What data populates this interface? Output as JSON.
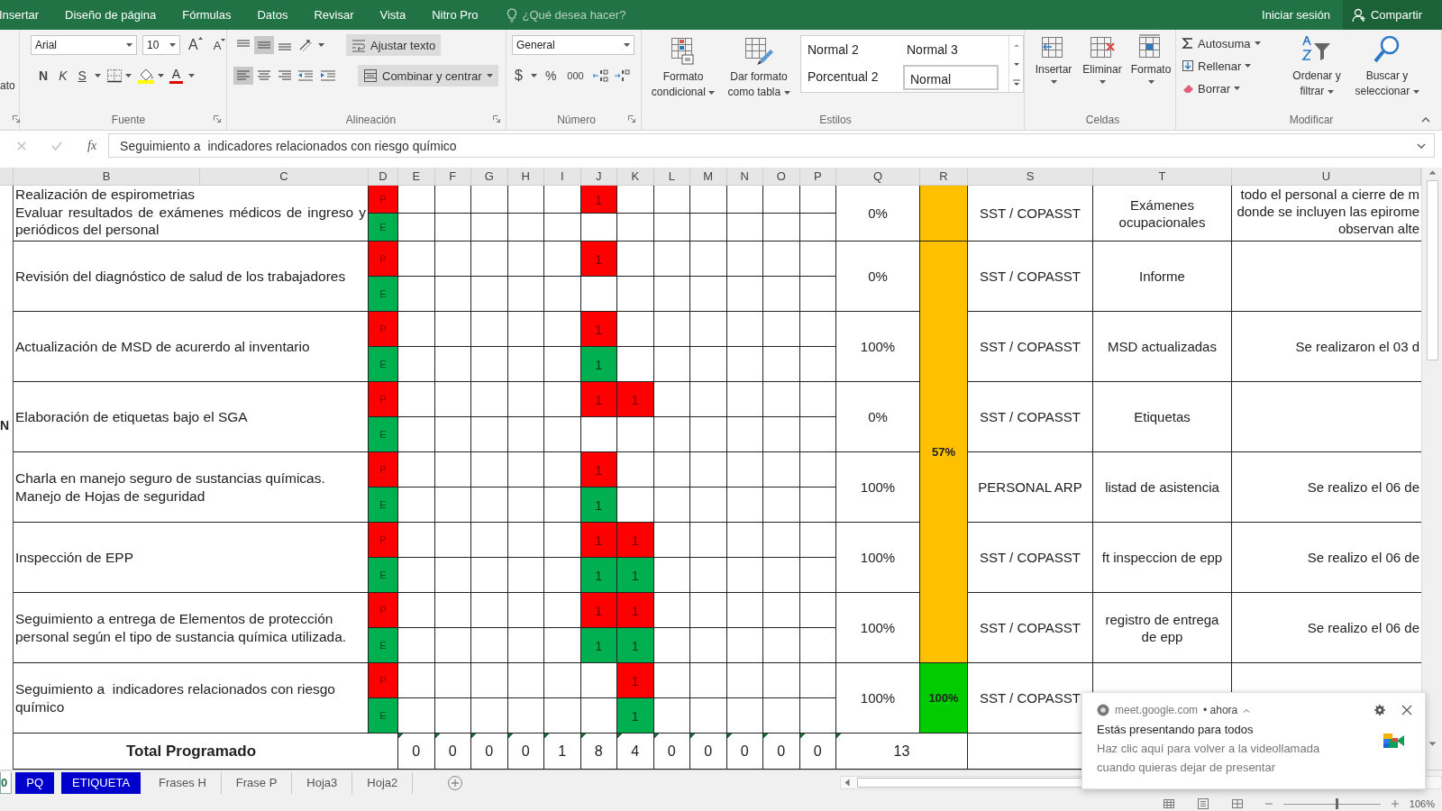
{
  "menu_tabs": [
    "Insertar",
    "Diseño de página",
    "Fórmulas",
    "Datos",
    "Revisar",
    "Vista",
    "Nitro Pro"
  ],
  "tell_me": {
    "placeholder": "¿Qué desea hacer?"
  },
  "account": {
    "sign_in": "Iniciar sesión",
    "share": "Compartir"
  },
  "ribbon": {
    "clipped_group": {
      "label": "ato"
    },
    "font": {
      "name": "Arial",
      "size": "10",
      "grow": "A",
      "shrink": "A",
      "bold": "N",
      "italic": "K",
      "underline": "S",
      "font_color": "A",
      "label": "Fuente"
    },
    "alignment": {
      "wrap_text": "Ajustar texto",
      "merge": "Combinar y centrar",
      "label": "Alineación"
    },
    "number": {
      "format": "General",
      "currency": "$",
      "percent": "%",
      "thousands": "000",
      "label": "Número"
    },
    "styles": {
      "conditional": "Formato condicional",
      "as_table": "Dar formato como tabla",
      "label": "Estilos",
      "gallery": [
        {
          "label": "Normal 2",
          "selected": false
        },
        {
          "label": "Normal 3",
          "selected": false
        },
        {
          "label": "Porcentual 2",
          "selected": false
        },
        {
          "label": "Normal",
          "selected": true
        }
      ]
    },
    "cells": {
      "buttons": [
        "Insertar",
        "Eliminar",
        "Formato"
      ],
      "label": "Celdas"
    },
    "editing": {
      "autosum": "Autosuma",
      "fill": "Rellenar",
      "clear": "Borrar",
      "sort": "Ordenar y filtrar",
      "find": "Buscar y seleccionar",
      "label": "Modificar"
    }
  },
  "formula_bar": {
    "function_label": "fx",
    "content": "Seguimiento a  indicadores relacionados con riesgo químico"
  },
  "sheet": {
    "columns": [
      "B",
      "C",
      "D",
      "E",
      "F",
      "G",
      "H",
      "I",
      "J",
      "K",
      "L",
      "M",
      "N",
      "O",
      "P",
      "Q",
      "R",
      "S",
      "T",
      "U"
    ],
    "column_a_fragment": "N",
    "tasks": [
      {
        "activity": "Realización de espirometrias\nEvaluar resultados de exámenes médicos de ingreso y periódicos del personal",
        "plan_label": "P",
        "exec_label": "E",
        "plan": [
          {
            "filled": false
          },
          {
            "filled": false
          },
          {
            "filled": false
          },
          {
            "filled": false
          },
          {
            "filled": false
          },
          {
            "filled": true,
            "value": "1"
          },
          {
            "filled": false
          },
          {
            "filled": false
          },
          {
            "filled": false
          },
          {
            "filled": false
          },
          {
            "filled": false
          },
          {
            "filled": false
          }
        ],
        "exec": [
          {
            "filled": false
          },
          {
            "filled": false
          },
          {
            "filled": false
          },
          {
            "filled": false
          },
          {
            "filled": false
          },
          {
            "filled": false
          },
          {
            "filled": false
          },
          {
            "filled": false
          },
          {
            "filled": false
          },
          {
            "filled": false
          },
          {
            "filled": false
          },
          {
            "filled": false
          }
        ],
        "percent": "0%",
        "summary": {
          "color": "#ffc000"
        },
        "responsible": "SST / COPASST",
        "evidence": "Exámenes ocupacionales",
        "observation": "todo el personal a cierre de m\ndonde se incluyen las epirome\nobservan alte"
      },
      {
        "activity": "Revisión del diagnóstico de salud de los trabajadores",
        "plan_label": "P",
        "exec_label": "E",
        "plan": [
          {
            "filled": false
          },
          {
            "filled": false
          },
          {
            "filled": false
          },
          {
            "filled": false
          },
          {
            "filled": false
          },
          {
            "filled": true,
            "value": "1"
          },
          {
            "filled": false
          },
          {
            "filled": false
          },
          {
            "filled": false
          },
          {
            "filled": false
          },
          {
            "filled": false
          },
          {
            "filled": false
          }
        ],
        "exec": [
          {
            "filled": false
          },
          {
            "filled": false
          },
          {
            "filled": false
          },
          {
            "filled": false
          },
          {
            "filled": false
          },
          {
            "filled": false
          },
          {
            "filled": false
          },
          {
            "filled": false
          },
          {
            "filled": false
          },
          {
            "filled": false
          },
          {
            "filled": false
          },
          {
            "filled": false
          }
        ],
        "percent": "0%",
        "summary": {
          "value": "57%",
          "color": "#ffc000"
        },
        "responsible": "SST / COPASST",
        "evidence": "Informe"
      },
      {
        "activity": "Actualización de MSD de acurerdo al inventario",
        "plan_label": "P",
        "exec_label": "E",
        "plan": [
          {
            "filled": false
          },
          {
            "filled": false
          },
          {
            "filled": false
          },
          {
            "filled": false
          },
          {
            "filled": false
          },
          {
            "filled": true,
            "value": "1"
          },
          {
            "filled": false
          },
          {
            "filled": false
          },
          {
            "filled": false
          },
          {
            "filled": false
          },
          {
            "filled": false
          },
          {
            "filled": false
          }
        ],
        "exec": [
          {
            "filled": false
          },
          {
            "filled": false
          },
          {
            "filled": false
          },
          {
            "filled": false
          },
          {
            "filled": false
          },
          {
            "filled": true,
            "value": "1"
          },
          {
            "filled": false
          },
          {
            "filled": false
          },
          {
            "filled": false
          },
          {
            "filled": false
          },
          {
            "filled": false
          },
          {
            "filled": false
          }
        ],
        "percent": "100%",
        "responsible": "SST / COPASST",
        "evidence": "MSD actualizadas",
        "observation": "Se realizaron el 03 d"
      },
      {
        "activity": "Elaboración de etiquetas bajo el SGA",
        "plan_label": "P",
        "exec_label": "E",
        "plan": [
          {
            "filled": false
          },
          {
            "filled": false
          },
          {
            "filled": false
          },
          {
            "filled": false
          },
          {
            "filled": false
          },
          {
            "filled": true,
            "value": "1"
          },
          {
            "filled": true,
            "value": "1"
          },
          {
            "filled": false
          },
          {
            "filled": false
          },
          {
            "filled": false
          },
          {
            "filled": false
          },
          {
            "filled": false
          }
        ],
        "exec": [
          {
            "filled": false
          },
          {
            "filled": false
          },
          {
            "filled": false
          },
          {
            "filled": false
          },
          {
            "filled": false
          },
          {
            "filled": false
          },
          {
            "filled": false
          },
          {
            "filled": false
          },
          {
            "filled": false
          },
          {
            "filled": false
          },
          {
            "filled": false
          },
          {
            "filled": false
          }
        ],
        "percent": "0%",
        "responsible": "SST / COPASST",
        "evidence": "Etiquetas"
      },
      {
        "activity": "Charla en manejo seguro de sustancias químicas.\nManejo de Hojas de seguridad",
        "plan_label": "P",
        "exec_label": "E",
        "plan": [
          {
            "filled": false
          },
          {
            "filled": false
          },
          {
            "filled": false
          },
          {
            "filled": false
          },
          {
            "filled": false
          },
          {
            "filled": true,
            "value": "1"
          },
          {
            "filled": false
          },
          {
            "filled": false
          },
          {
            "filled": false
          },
          {
            "filled": false
          },
          {
            "filled": false
          },
          {
            "filled": false
          }
        ],
        "exec": [
          {
            "filled": false
          },
          {
            "filled": false
          },
          {
            "filled": false
          },
          {
            "filled": false
          },
          {
            "filled": false
          },
          {
            "filled": true,
            "value": "1"
          },
          {
            "filled": false
          },
          {
            "filled": false
          },
          {
            "filled": false
          },
          {
            "filled": false
          },
          {
            "filled": false
          },
          {
            "filled": false
          }
        ],
        "percent": "100%",
        "responsible": "PERSONAL ARP",
        "evidence": "listad de asistencia",
        "observation": "Se realizo el 06 de"
      },
      {
        "activity": "Inspección de EPP",
        "plan_label": "P",
        "exec_label": "E",
        "plan": [
          {
            "filled": false
          },
          {
            "filled": false
          },
          {
            "filled": false
          },
          {
            "filled": false
          },
          {
            "filled": false
          },
          {
            "filled": true,
            "value": "1"
          },
          {
            "filled": true,
            "value": "1"
          },
          {
            "filled": false
          },
          {
            "filled": false
          },
          {
            "filled": false
          },
          {
            "filled": false
          },
          {
            "filled": false
          }
        ],
        "exec": [
          {
            "filled": false
          },
          {
            "filled": false
          },
          {
            "filled": false
          },
          {
            "filled": false
          },
          {
            "filled": false
          },
          {
            "filled": true,
            "value": "1"
          },
          {
            "filled": true,
            "value": "1"
          },
          {
            "filled": false
          },
          {
            "filled": false
          },
          {
            "filled": false
          },
          {
            "filled": false
          },
          {
            "filled": false
          }
        ],
        "percent": "100%",
        "responsible": "SST / COPASST",
        "evidence": "ft inspeccion de epp",
        "observation": "Se realizo el 06 de"
      },
      {
        "activity": "Seguimiento a entrega de Elementos de protección personal según el tipo de sustancia química utilizada.",
        "plan_label": "P",
        "exec_label": "E",
        "plan": [
          {
            "filled": false
          },
          {
            "filled": false
          },
          {
            "filled": false
          },
          {
            "filled": false
          },
          {
            "filled": false
          },
          {
            "filled": true,
            "value": "1"
          },
          {
            "filled": true,
            "value": "1"
          },
          {
            "filled": false
          },
          {
            "filled": false
          },
          {
            "filled": false
          },
          {
            "filled": false
          },
          {
            "filled": false
          }
        ],
        "exec": [
          {
            "filled": false
          },
          {
            "filled": false
          },
          {
            "filled": false
          },
          {
            "filled": false
          },
          {
            "filled": false
          },
          {
            "filled": true,
            "value": "1"
          },
          {
            "filled": true,
            "value": "1"
          },
          {
            "filled": false
          },
          {
            "filled": false
          },
          {
            "filled": false
          },
          {
            "filled": false
          },
          {
            "filled": false
          }
        ],
        "percent": "100%",
        "responsible": "SST / COPASST",
        "evidence": "registro de entrega de epp",
        "observation": "Se realizo el 06 de"
      },
      {
        "activity": "Seguimiento a  indicadores relacionados con riesgo químico",
        "plan_label": "P",
        "exec_label": "E",
        "plan": [
          {
            "filled": false
          },
          {
            "filled": false
          },
          {
            "filled": false
          },
          {
            "filled": false
          },
          {
            "filled": false
          },
          {
            "filled": false
          },
          {
            "filled": true,
            "value": "1"
          },
          {
            "filled": false
          },
          {
            "filled": false
          },
          {
            "filled": false
          },
          {
            "filled": false
          },
          {
            "filled": false
          }
        ],
        "exec": [
          {
            "filled": false
          },
          {
            "filled": false
          },
          {
            "filled": false
          },
          {
            "filled": false
          },
          {
            "filled": false
          },
          {
            "filled": false
          },
          {
            "filled": true,
            "value": "1"
          },
          {
            "filled": false
          },
          {
            "filled": false
          },
          {
            "filled": false
          },
          {
            "filled": false
          },
          {
            "filled": false
          }
        ],
        "percent": "100%",
        "summary": {
          "value": "100%",
          "color": "#00cc00"
        },
        "responsible": "SST / COPASST"
      }
    ],
    "total": {
      "label": "Total Programado",
      "values": [
        "0",
        "0",
        "0",
        "0",
        "1",
        "8",
        "4",
        "0",
        "0",
        "0",
        "0",
        "0"
      ],
      "sum": "13"
    }
  },
  "sheet_tabs": [
    {
      "label": "0",
      "selected": true
    },
    {
      "label": "PQ",
      "selected": false,
      "color": "#0000cc"
    },
    {
      "label": "ETIQUETA",
      "selected": false,
      "color": "#0000cc"
    },
    {
      "label": "Frases H",
      "selected": false
    },
    {
      "label": "Frase P",
      "selected": false
    },
    {
      "label": "Hoja3",
      "selected": false
    },
    {
      "label": "Hoja2",
      "selected": false
    }
  ],
  "status_bar": {
    "zoom": "106%",
    "zoom_slider": {
      "level": 0.55
    }
  },
  "notification": {
    "source": "meet.google.com",
    "time": "• ahora",
    "title": "Estás presentando para todos",
    "message": "Haz clic aquí para volver a la videollamada cuando quieras dejar de presentar"
  }
}
